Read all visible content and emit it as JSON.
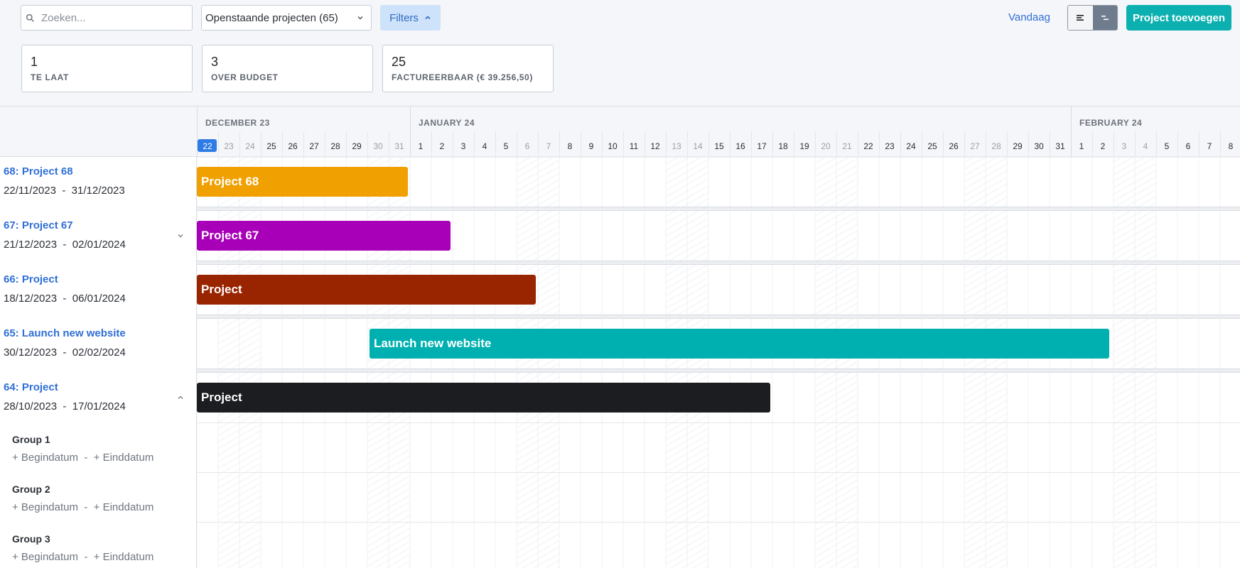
{
  "toolbar": {
    "search_placeholder": "Zoeken...",
    "status_select": "Openstaande projecten (65)",
    "filters_label": "Filters",
    "today_label": "Vandaag",
    "add_project_label": "Project toevoegen"
  },
  "stats": [
    {
      "value": "1",
      "label": "TE LAAT"
    },
    {
      "value": "3",
      "label": "OVER BUDGET"
    },
    {
      "value": "25",
      "label": "FACTUREERBAAR (€ 39.256,50)"
    }
  ],
  "timeline": {
    "months": [
      {
        "label": "DECEMBER 23",
        "start_day_index": 0
      },
      {
        "label": "JANUARY 24",
        "start_day_index": 10
      },
      {
        "label": "FEBRUARY 24",
        "start_day_index": 41
      }
    ],
    "days": [
      "22",
      "23",
      "24",
      "25",
      "26",
      "27",
      "28",
      "29",
      "30",
      "31",
      "1",
      "2",
      "3",
      "4",
      "5",
      "6",
      "7",
      "8",
      "9",
      "10",
      "11",
      "12",
      "13",
      "14",
      "15",
      "16",
      "17",
      "18",
      "19",
      "20",
      "21",
      "22",
      "23",
      "24",
      "25",
      "26",
      "27",
      "28",
      "29",
      "30",
      "31",
      "1",
      "2",
      "3",
      "4",
      "5",
      "6",
      "7",
      "8"
    ],
    "today_index": 0,
    "weekend_indices": [
      1,
      2,
      8,
      9,
      15,
      16,
      22,
      23,
      29,
      30,
      36,
      37,
      43,
      44
    ]
  },
  "projects": [
    {
      "id": "p68",
      "title": "68: Project 68",
      "start": "22/11/2023",
      "end": "31/12/2023",
      "bar_label": "Project 68",
      "color": "#f0a000",
      "bar_start_day": 0,
      "bar_end_day": 10,
      "chevron": "none"
    },
    {
      "id": "p67",
      "title": "67: Project 67",
      "start": "21/12/2023",
      "end": "02/01/2024",
      "bar_label": "Project 67",
      "color": "#a800b8",
      "bar_start_day": 0,
      "bar_end_day": 12,
      "chevron": "down"
    },
    {
      "id": "p66",
      "title": "66: Project",
      "start": "18/12/2023",
      "end": "06/01/2024",
      "bar_label": "Project",
      "color": "#992400",
      "bar_start_day": 0,
      "bar_end_day": 16,
      "chevron": "none"
    },
    {
      "id": "p65",
      "title": "65: Launch new website",
      "start": "30/12/2023",
      "end": "02/02/2024",
      "bar_label": "Launch new website",
      "color": "#00b0b0",
      "bar_start_day": 8.1,
      "bar_end_day": 42.9,
      "chevron": "none"
    },
    {
      "id": "p64",
      "title": "64: Project",
      "start": "28/10/2023",
      "end": "17/01/2024",
      "bar_label": "Project",
      "color": "#1c1d21",
      "bar_start_day": 0,
      "bar_end_day": 27,
      "chevron": "up"
    }
  ],
  "groups": [
    {
      "name": "Group 1",
      "start_placeholder": "+ Begindatum",
      "end_placeholder": "+ Einddatum"
    },
    {
      "name": "Group 2",
      "start_placeholder": "+ Begindatum",
      "end_placeholder": "+ Einddatum"
    },
    {
      "name": "Group 3",
      "start_placeholder": "+ Begindatum",
      "end_placeholder": "+ Einddatum"
    }
  ],
  "date_separator": "-"
}
